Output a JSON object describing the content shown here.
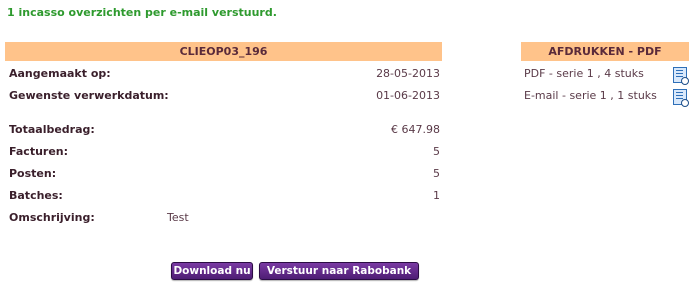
{
  "notice": "1 incasso overzichten per e-mail verstuurd.",
  "panel": {
    "title": "CLIEOP03_196",
    "rows_top": [
      {
        "label": "Aangemaakt op:",
        "value": "28-05-2013"
      },
      {
        "label": "Gewenste verwerkdatum:",
        "value": "01-06-2013"
      }
    ],
    "rows_bottom": [
      {
        "label": "Totaalbedrag:",
        "value": "€ 647.98"
      },
      {
        "label": "Facturen:",
        "value": "5"
      },
      {
        "label": "Posten:",
        "value": "5"
      },
      {
        "label": "Batches:",
        "value": "1"
      }
    ],
    "description_label": "Omschrijving:",
    "description_value": "Test"
  },
  "buttons": {
    "download": "Download nu",
    "send": "Verstuur naar Rabobank"
  },
  "print": {
    "title": "AFDRUKKEN - PDF",
    "items": [
      {
        "text": "PDF - serie 1     , 4 stuks",
        "icon": "pdf-document-icon"
      },
      {
        "text": "E-mail - serie 1 , 1 stuks",
        "icon": "pdf-document-icon"
      }
    ]
  },
  "colors": {
    "notice": "#2e9a2e",
    "header_bg": "#ffc38a",
    "button_bg": "#5e2a86"
  }
}
